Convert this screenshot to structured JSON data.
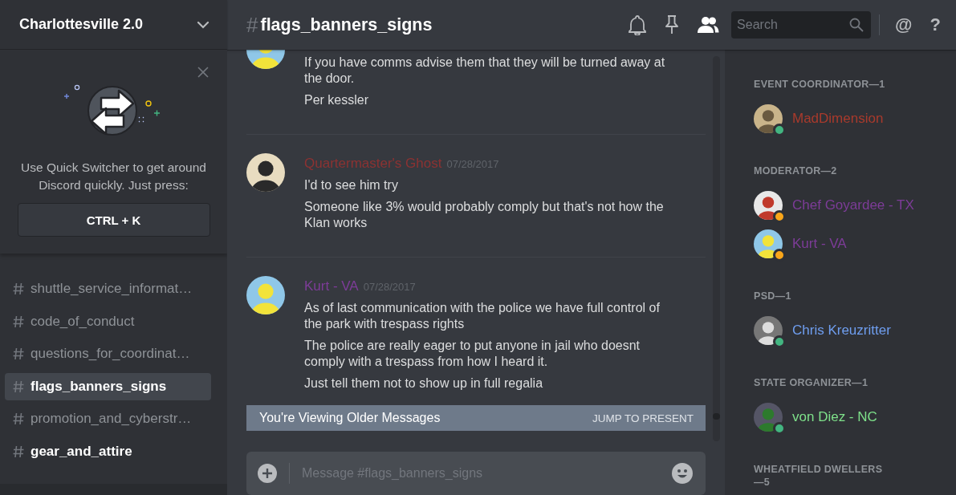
{
  "server": {
    "name": "Charlottesville 2.0"
  },
  "quick_switcher": {
    "text": "Use Quick Switcher to get around Discord quickly. Just press:",
    "shortcut": "CTRL + K"
  },
  "channels": [
    {
      "name": "shuttle_service_informat…",
      "selected": false,
      "unread": false
    },
    {
      "name": "code_of_conduct",
      "selected": false,
      "unread": false
    },
    {
      "name": "questions_for_coordinat…",
      "selected": false,
      "unread": false
    },
    {
      "name": "flags_banners_signs",
      "selected": true,
      "unread": false
    },
    {
      "name": "promotion_and_cyberstr…",
      "selected": false,
      "unread": false
    },
    {
      "name": "gear_and_attire",
      "selected": false,
      "unread": true
    }
  ],
  "channel_header": {
    "hash": "#",
    "name": "flags_banners_signs",
    "member_list_visible": true,
    "search_placeholder": "Search",
    "mentions_label": "@",
    "help_label": "?"
  },
  "messages": [
    {
      "lines": [
        "If you have comms advise them that they will be turned away at the door.",
        "Per kessler"
      ]
    },
    {
      "author": "Quartermaster's Ghost",
      "color": "#8c3232",
      "time": "07/28/2017",
      "lines": [
        "I'd to see him try",
        "Someone like 3% would probably comply but that's not how the Klan works"
      ]
    },
    {
      "author": "Kurt - VA",
      "color": "#7d3c98",
      "time": "07/28/2017",
      "lines": [
        "As of last communication with the police we have full control of the park with trespass rights",
        "The police are really eager to put anyone in jail who doesnt comply with a trespass from how I heard it.",
        "Just tell them not to show up in full regalia"
      ]
    }
  ],
  "older_messages_bar": {
    "text": "You're Viewing Older Messages",
    "action": "JUMP TO PRESENT"
  },
  "composer": {
    "placeholder": "Message #flags_banners_signs"
  },
  "member_groups": [
    {
      "title": "EVENT COORDINATOR—1",
      "members": [
        {
          "name": "MadDimension",
          "color": "#a93a2c",
          "presence": {
            "color": "#43b581"
          }
        }
      ]
    },
    {
      "title": "MODERATOR—2",
      "members": [
        {
          "name": "Chef Goyardee - TX",
          "color": "#7d3c98",
          "presence": {
            "color": "#faa61a"
          }
        },
        {
          "name": "Kurt - VA",
          "color": "#7d3c98",
          "presence": {
            "color": "#faa61a"
          }
        }
      ]
    },
    {
      "title": "PSD—1",
      "members": [
        {
          "name": "Chris Kreuzritter",
          "color": "#6f9ef0",
          "presence": {
            "color": "#43b581"
          }
        }
      ]
    },
    {
      "title": "STATE ORGANIZER—1",
      "members": [
        {
          "name": "von Diez - NC",
          "color": "#7ee08a",
          "presence": {
            "color": "#43b581"
          }
        }
      ]
    },
    {
      "title": "WHEATFIELD DWELLERS—5"
    }
  ]
}
